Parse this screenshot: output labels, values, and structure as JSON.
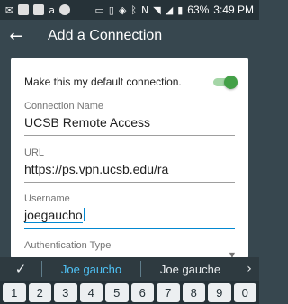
{
  "status_bar": {
    "notification_icons": [
      {
        "name": "mail-icon",
        "glyph": "M"
      },
      {
        "name": "picture-icon",
        "glyph": "▣"
      },
      {
        "name": "app-icon",
        "glyph": "◼"
      },
      {
        "name": "amazon-icon",
        "glyph": "a"
      },
      {
        "name": "chat-icon",
        "glyph": "◉"
      }
    ],
    "battery": "63%",
    "time": "3:49 PM"
  },
  "app_bar": {
    "title": "Add a Connection"
  },
  "form": {
    "default_toggle_label": "Make this my default connection.",
    "default_toggle_on": true,
    "connection_name_label": "Connection Name",
    "connection_name_value": "UCSB Remote Access",
    "url_label": "URL",
    "url_value": "https://ps.vpn.ucsb.edu/ra",
    "username_label": "Username",
    "username_value": "joegaucho",
    "auth_type_label": "Authentication Type"
  },
  "colors": {
    "app_bar": "#37474f",
    "accent": "#0288d1",
    "toggle_on": "#43a047"
  },
  "suggestions": {
    "items": [
      "Joe gaucho",
      "Joe gauche"
    ]
  },
  "keyboard": {
    "number_row": [
      "1",
      "2",
      "3",
      "4",
      "5",
      "6",
      "7",
      "8",
      "9",
      "0"
    ]
  }
}
